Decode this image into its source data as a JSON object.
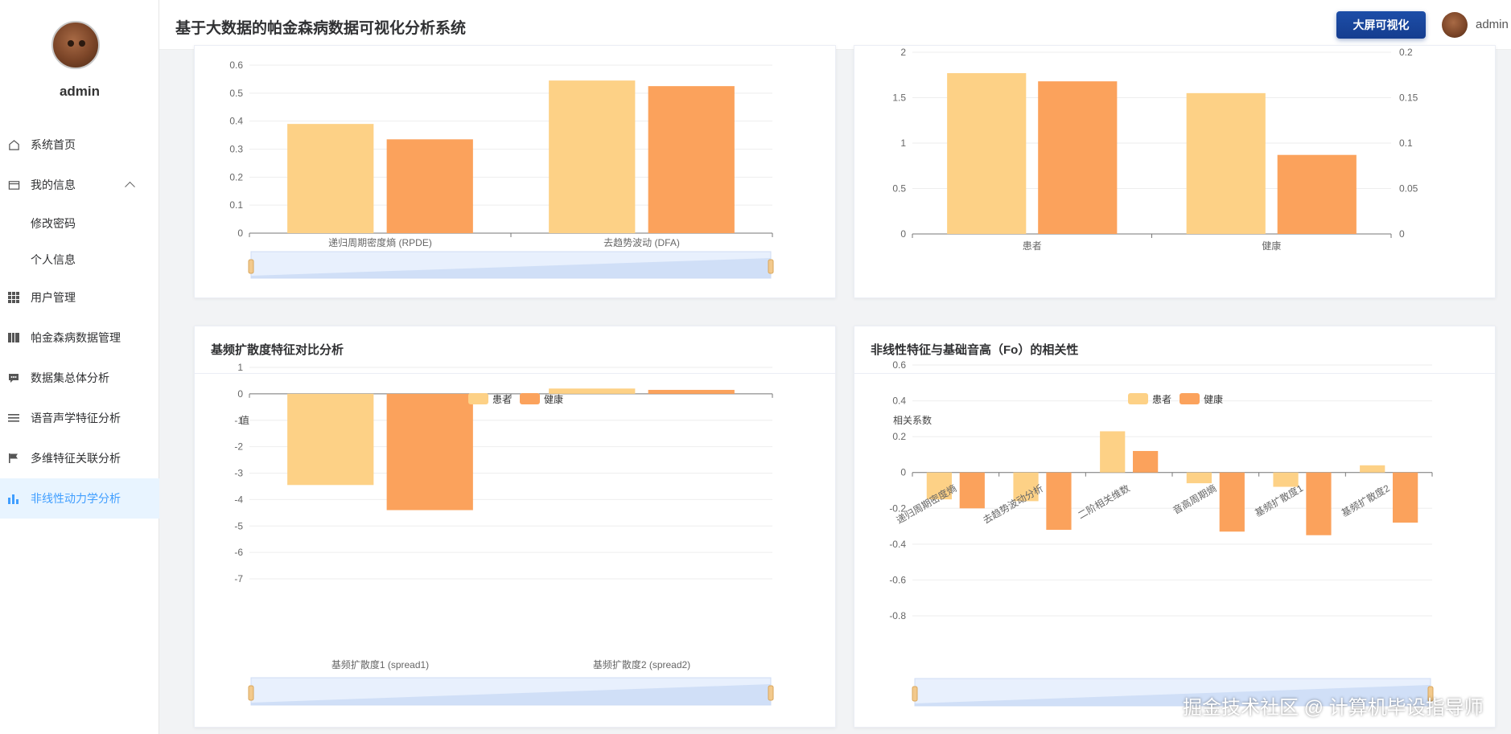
{
  "sidebar": {
    "username": "admin",
    "items": [
      {
        "label": "系统首页",
        "icon": "home-icon"
      },
      {
        "label": "我的信息",
        "icon": "id-card-icon"
      },
      {
        "label": "修改密码",
        "icon": ""
      },
      {
        "label": "个人信息",
        "icon": ""
      },
      {
        "label": "用户管理",
        "icon": "grid-icon"
      },
      {
        "label": "帕金森病数据管理",
        "icon": "folder-icon"
      },
      {
        "label": "数据集总体分析",
        "icon": "chat-icon"
      },
      {
        "label": "语音声学特征分析",
        "icon": "list-icon"
      },
      {
        "label": "多维特征关联分析",
        "icon": "flag-icon"
      },
      {
        "label": "非线性动力学分析",
        "icon": "bar-chart-icon"
      }
    ]
  },
  "header": {
    "title": "基于大数据的帕金森病数据可视化分析系统",
    "bigscreen_label": "大屏可视化",
    "user": "admin"
  },
  "cards": {
    "c3_title": "基频扩散度特征对比分析",
    "c4_title": "非线性特征与基础音高（Fo）的相关性"
  },
  "watermark": "掘金技术社区 @ 计算机毕设指导师",
  "colors": {
    "patient": "#fdd186",
    "healthy": "#fba25c",
    "accent": "#409eff"
  },
  "chart_data": [
    {
      "type": "bar",
      "categories": [
        "递归周期密度熵 (RPDE)",
        "去趋势波动 (DFA)"
      ],
      "series": [
        {
          "values": [
            0.39,
            0.545
          ]
        },
        {
          "values": [
            0.335,
            0.525
          ]
        }
      ],
      "y_ticks": [
        "0.6",
        "0.5",
        "0.4",
        "0.3",
        "0.2",
        "0.1",
        "0"
      ],
      "ylim": [
        0,
        0.6
      ]
    },
    {
      "type": "bar",
      "categories": [
        "患者",
        "健康"
      ],
      "series": [
        {
          "values": [
            1.77,
            1.55
          ]
        },
        {
          "values": [
            0.168,
            0.087
          ],
          "axis": "right"
        }
      ],
      "y_ticks": [
        "2",
        "1.5",
        "1",
        "0.5",
        "0"
      ],
      "y2_ticks": [
        "0.2",
        "0.15",
        "0.1",
        "0.05",
        "0"
      ],
      "ylim": [
        0,
        2
      ],
      "y2lim": [
        0,
        0.2
      ]
    },
    {
      "type": "bar",
      "legend": [
        "患者",
        "健康"
      ],
      "ylabel": "值",
      "categories": [
        "基频扩散度1 (spread1)",
        "基频扩散度2 (spread2)"
      ],
      "series": [
        {
          "name": "患者",
          "values": [
            -3.45,
            0.2
          ]
        },
        {
          "name": "健康",
          "values": [
            -4.4,
            0.15
          ]
        }
      ],
      "y_ticks": [
        "1",
        "0",
        "-1",
        "-2",
        "-3",
        "-4",
        "-5",
        "-6",
        "-7"
      ],
      "ylim": [
        -7,
        1
      ]
    },
    {
      "type": "bar",
      "legend": [
        "患者",
        "健康"
      ],
      "ylabel": "相关系数",
      "categories": [
        "递归周期密度熵",
        "去趋势波动分析",
        "二阶相关维数",
        "音高周期熵",
        "基频扩散度1",
        "基频扩散度2"
      ],
      "series": [
        {
          "name": "患者",
          "values": [
            -0.15,
            -0.16,
            0.23,
            -0.06,
            -0.08,
            0.04
          ]
        },
        {
          "name": "健康",
          "values": [
            -0.2,
            -0.32,
            0.12,
            -0.33,
            -0.35,
            -0.28
          ]
        }
      ],
      "y_ticks": [
        "0.6",
        "0.4",
        "0.2",
        "0",
        "-0.2",
        "-0.4",
        "-0.6",
        "-0.8"
      ],
      "ylim": [
        -0.8,
        0.6
      ]
    }
  ]
}
